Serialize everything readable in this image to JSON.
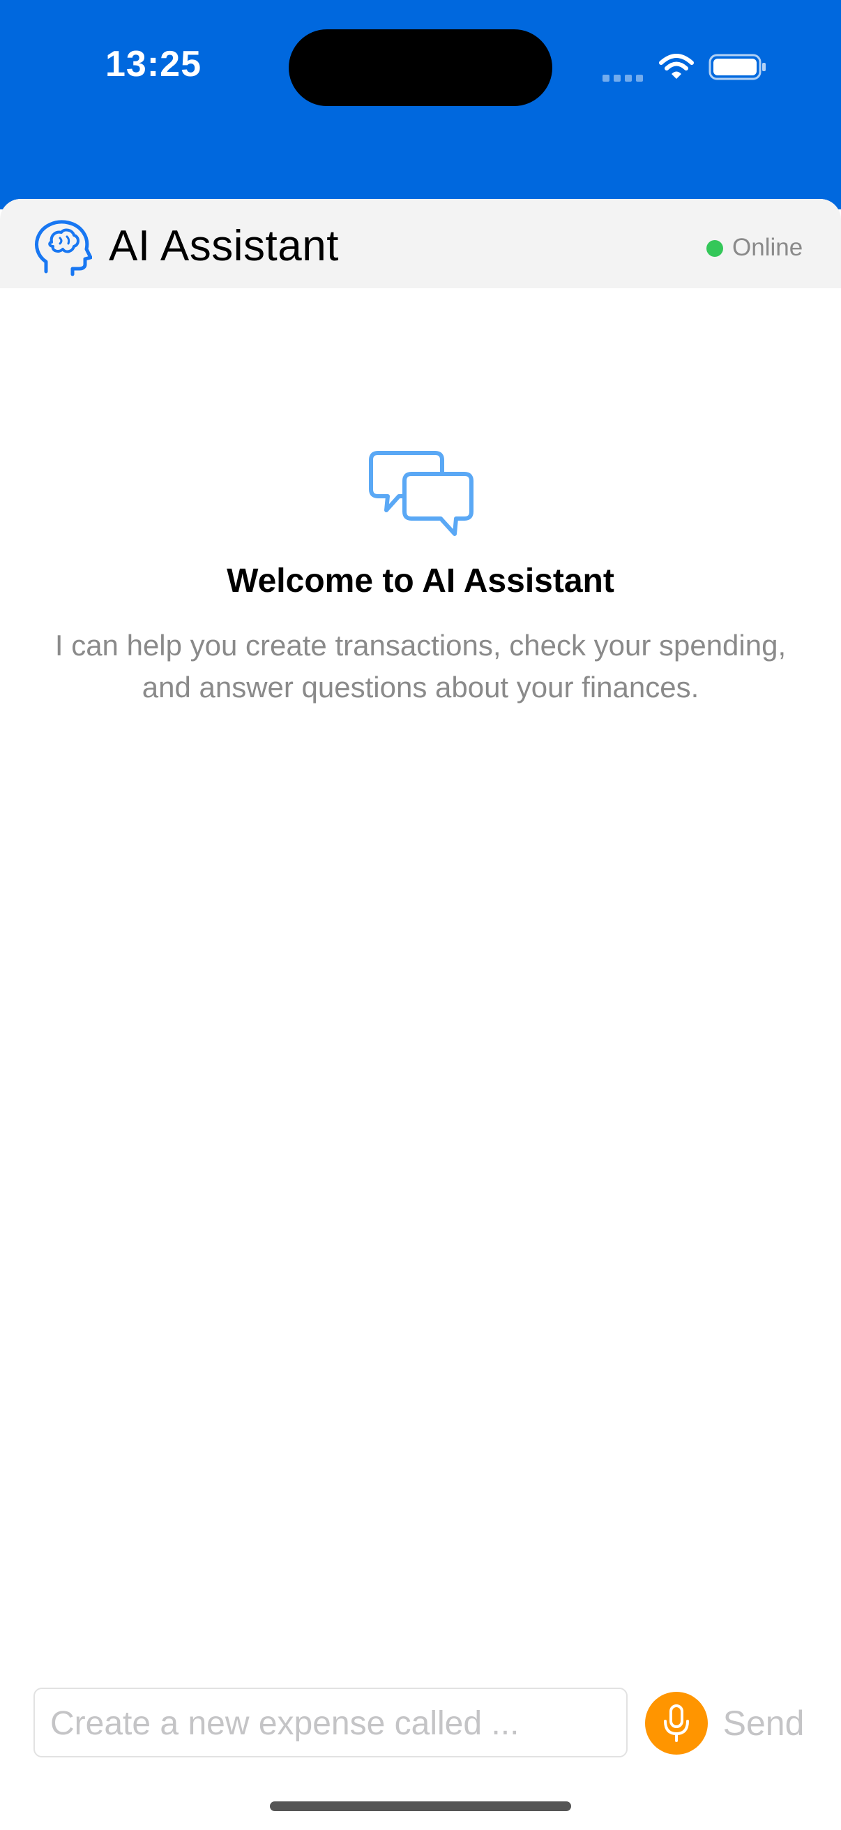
{
  "status_bar": {
    "time": "13:25",
    "background_color": "#0068DE",
    "icons": [
      "cellular-signal-icon",
      "wifi-icon",
      "battery-icon"
    ]
  },
  "header": {
    "title": "AI Assistant",
    "status": "Online",
    "status_color": "#34C759",
    "icon": "brain-head-icon",
    "icon_color": "#1877F2"
  },
  "empty_state": {
    "icon": "chat-bubbles-icon",
    "title": "Welcome to AI Assistant",
    "description": "I can help you create transactions, check your spending, and answer questions about your finances."
  },
  "composer": {
    "placeholder": "Create a new expense called ...",
    "value": "",
    "mic_icon": "microphone-icon",
    "mic_color": "#FF9500",
    "send_label": "Send"
  }
}
